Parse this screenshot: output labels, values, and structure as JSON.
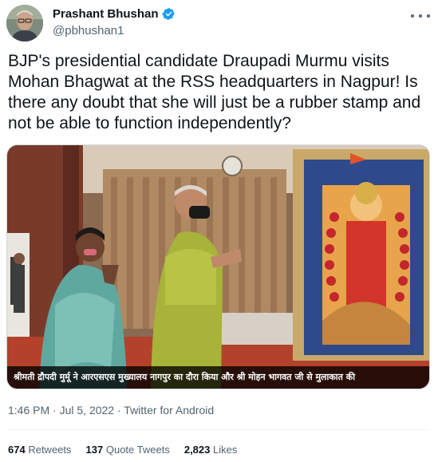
{
  "author": {
    "display_name": "Prashant Bhushan",
    "handle": "@pbhushan1",
    "verified": true,
    "avatar_icon": "profile-photo"
  },
  "tweet": {
    "text": "BJP's presidential candidate Draupadi Murmu visits Mohan Bhagwat at the RSS headquarters in Nagpur! Is there any doubt that she will just be a rubber stamp and not be able to function independently?"
  },
  "media": {
    "caption": "श्रीमती द्रौपदी मुर्मू ने आरएसएस मुख्यालय नागपुर का दौरा किया और श्री मोहन भागवत जी से मुलाकात की"
  },
  "meta": {
    "time": "1:46 PM",
    "date": "Jul 5, 2022",
    "source": "Twitter for Android",
    "separator": " · "
  },
  "stats": {
    "retweets_count": "674",
    "retweets_label": "Retweets",
    "quotes_count": "137",
    "quotes_label": "Quote Tweets",
    "likes_count": "2,823",
    "likes_label": "Likes"
  },
  "colors": {
    "text": "#0f1419",
    "secondary": "#536471",
    "verified_blue": "#1d9bf0",
    "border": "#cfd9de"
  }
}
